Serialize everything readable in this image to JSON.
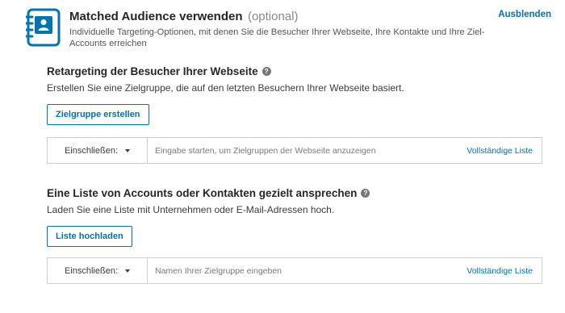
{
  "header": {
    "icon": "contact-book-icon",
    "title": "Matched Audience verwenden",
    "optional": "(optional)",
    "description": "Individuelle Targeting-Optionen, mit denen Sie die Besucher Ihrer Webseite, Ihre Kontakte und Ihre Ziel-Accounts erreichen",
    "hide_label": "Ausblenden"
  },
  "retargeting": {
    "title": "Retargeting der Besucher Ihrer Webseite",
    "help_icon": "question-circle-icon",
    "description": "Erstellen Sie eine Zielgruppe, die auf den letzten Besuchern Ihrer Webseite basiert.",
    "button_label": "Zielgruppe erstellen",
    "selector": {
      "dropdown_value": "Einschließen:",
      "placeholder": "Eingabe starten, um Zielgruppen der Webseite anzuzeigen",
      "link_label": "Vollständige Liste"
    }
  },
  "accounts": {
    "title": "Eine Liste von Accounts oder Kontakten gezielt ansprechen",
    "help_icon": "question-circle-icon",
    "description": "Laden Sie eine Liste mit Unternehmen oder E-Mail-Adressen hoch.",
    "button_label": "Liste hochladen",
    "selector": {
      "dropdown_value": "Einschließen:",
      "placeholder": "Namen Ihrer Zielgruppe eingeben",
      "link_label": "Vollständige Liste"
    }
  },
  "colors": {
    "accent": "#0073b1",
    "text": "#262626",
    "muted": "#8a8a8a",
    "border": "#d0d0d0"
  }
}
